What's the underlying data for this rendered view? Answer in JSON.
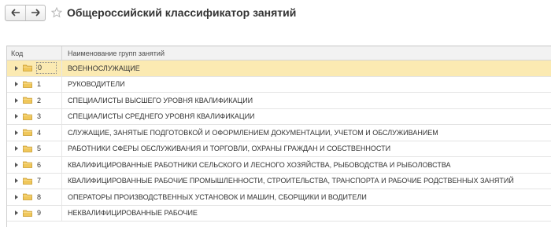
{
  "toolbar": {
    "back_icon": "arrow-left-icon",
    "forward_icon": "arrow-right-icon",
    "favorite_icon": "star-icon",
    "title": "Общероссийский классификатор занятий"
  },
  "grid": {
    "columns": [
      "Код",
      "Наименование групп занятий"
    ],
    "selected_index": 0,
    "rows": [
      {
        "code": "0",
        "name": "ВОЕННОСЛУЖАЩИЕ"
      },
      {
        "code": "1",
        "name": "РУКОВОДИТЕЛИ"
      },
      {
        "code": "2",
        "name": "СПЕЦИАЛИСТЫ ВЫСШЕГО УРОВНЯ КВАЛИФИКАЦИИ"
      },
      {
        "code": "3",
        "name": "СПЕЦИАЛИСТЫ СРЕДНЕГО УРОВНЯ КВАЛИФИКАЦИИ"
      },
      {
        "code": "4",
        "name": "СЛУЖАЩИЕ, ЗАНЯТЫЕ ПОДГОТОВКОЙ И ОФОРМЛЕНИЕМ ДОКУМЕНТАЦИИ, УЧЕТОМ И ОБСЛУЖИВАНИЕМ"
      },
      {
        "code": "5",
        "name": "РАБОТНИКИ СФЕРЫ ОБСЛУЖИВАНИЯ И ТОРГОВЛИ, ОХРАНЫ ГРАЖДАН И СОБСТВЕННОСТИ"
      },
      {
        "code": "6",
        "name": "КВАЛИФИЦИРОВАННЫЕ РАБОТНИКИ СЕЛЬСКОГО И ЛЕСНОГО ХОЗЯЙСТВА, РЫБОВОДСТВА И РЫБОЛОВСТВА"
      },
      {
        "code": "7",
        "name": "КВАЛИФИЦИРОВАННЫЕ РАБОЧИЕ ПРОМЫШЛЕННОСТИ, СТРОИТЕЛЬСТВА, ТРАНСПОРТА И РАБОЧИЕ РОДСТВЕННЫХ ЗАНЯТИЙ"
      },
      {
        "code": "8",
        "name": "ОПЕРАТОРЫ ПРОИЗВОДСТВЕННЫХ УСТАНОВОК И МАШИН, СБОРЩИКИ И ВОДИТЕЛИ"
      },
      {
        "code": "9",
        "name": "НЕКВАЛИФИЦИРОВАННЫЕ РАБОЧИЕ"
      }
    ],
    "row_icons": {
      "expand": "expand-triangle-icon",
      "group": "folder-icon"
    }
  },
  "colors": {
    "selected_row": "#fbeab2",
    "folder": "#f0c75a",
    "header_bg": "#f2f2f2"
  }
}
